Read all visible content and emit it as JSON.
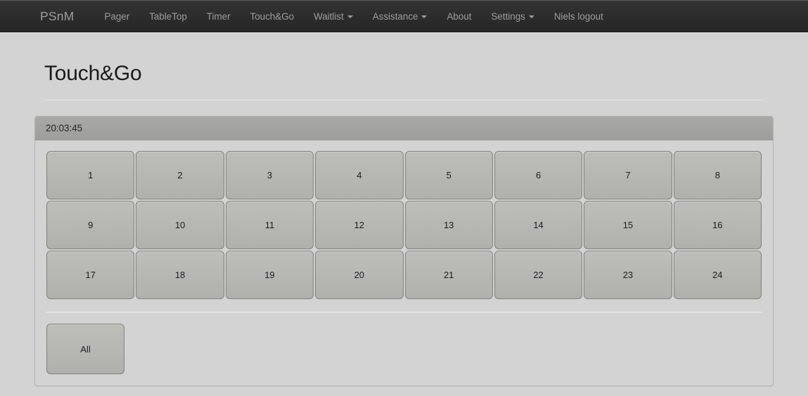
{
  "navbar": {
    "brand": "PSnM",
    "items": [
      {
        "label": "Pager",
        "caret": false
      },
      {
        "label": "TableTop",
        "caret": false
      },
      {
        "label": "Timer",
        "caret": false
      },
      {
        "label": "Touch&Go",
        "caret": false
      },
      {
        "label": "Waitlist",
        "caret": true
      },
      {
        "label": "Assistance",
        "caret": true
      },
      {
        "label": "About",
        "caret": false
      },
      {
        "label": "Settings",
        "caret": true
      },
      {
        "label": "Niels logout",
        "caret": false
      }
    ]
  },
  "page": {
    "title": "Touch&Go"
  },
  "panel": {
    "heading_time": "20:03:45",
    "tables": [
      "1",
      "2",
      "3",
      "4",
      "5",
      "6",
      "7",
      "8",
      "9",
      "10",
      "11",
      "12",
      "13",
      "14",
      "15",
      "16",
      "17",
      "18",
      "19",
      "20",
      "21",
      "22",
      "23",
      "24"
    ],
    "all_label": "All"
  },
  "colors": {
    "navbar_bg": "#2b2b2b",
    "navbar_text": "#9d9d9d",
    "body_bg": "#d3d3d3",
    "panel_heading_bg": "#a3a3a1",
    "panel_border": "#b4b4b4",
    "button_bg": "#b4b4b0",
    "button_border": "#82827a",
    "text": "#1d1d1d"
  }
}
